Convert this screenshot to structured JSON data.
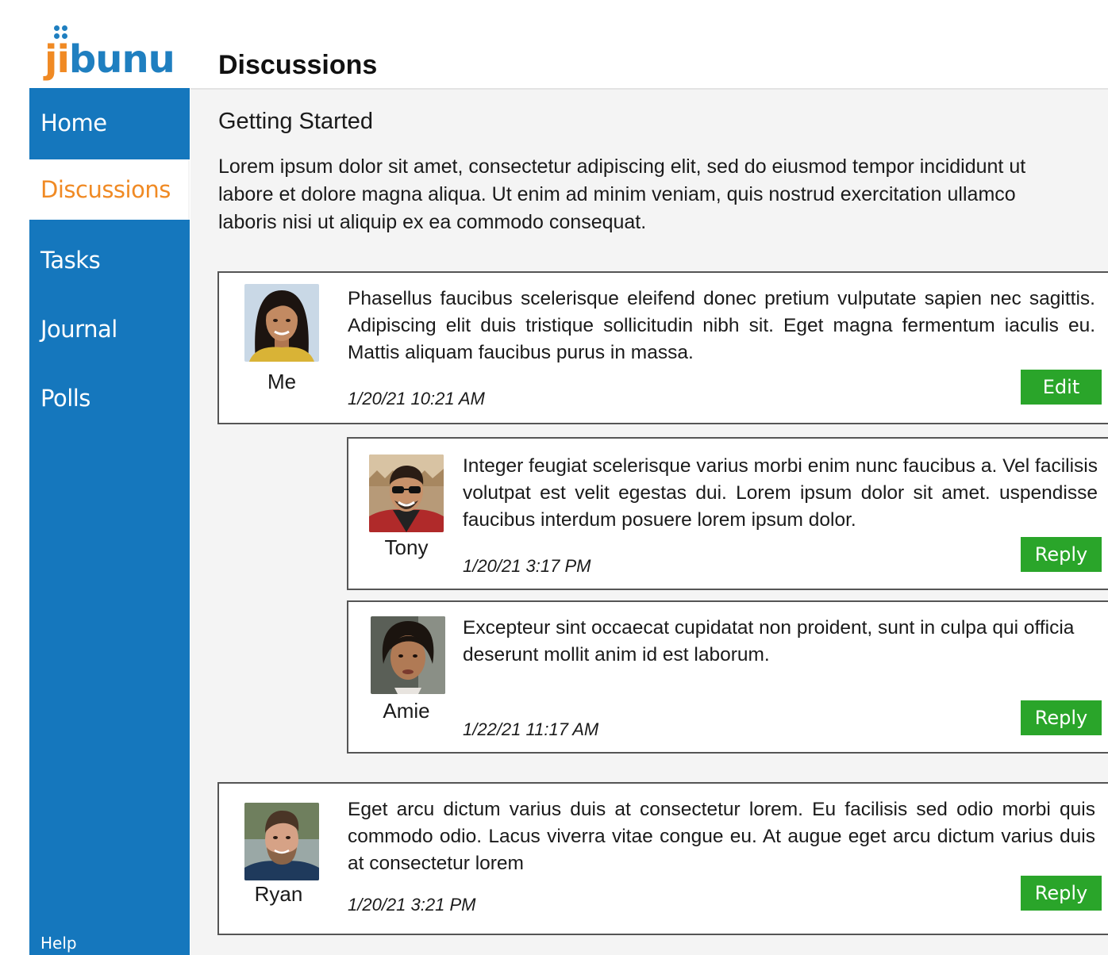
{
  "logo": {
    "prefix": "ji",
    "suffix": "bunu"
  },
  "page_title": "Discussions",
  "sidebar": {
    "items": [
      {
        "label": "Home"
      },
      {
        "label": "Discussions"
      },
      {
        "label": "Tasks"
      },
      {
        "label": "Journal"
      },
      {
        "label": "Polls"
      }
    ],
    "help_label": "Help"
  },
  "topic": {
    "title": "Getting Started",
    "description": [
      "Lorem ipsum dolor sit amet, consectetur adipiscing elit, sed do eiusmod tempor incididunt ut",
      "labore et dolore magna aliqua. Ut enim ad minim veniam, quis nostrud exercitation ullamco",
      "laboris nisi ut aliquip ex ea commodo consequat."
    ]
  },
  "posts": [
    {
      "author": "Me",
      "avatar_icon": "avatar-me-photo",
      "text": "Phasellus faucibus scelerisque eleifend donec pretium vulputate sapien nec sagittis. Adipiscing elit duis tristique sollicitudin nibh sit. Eget magna fermentum iaculis eu. Mattis aliquam faucibus purus in massa.",
      "timestamp": "1/20/21 10:21 AM",
      "button": "Edit"
    },
    {
      "author": "Tony",
      "avatar_icon": "avatar-tony-photo",
      "text": "Integer feugiat scelerisque varius morbi enim nunc faucibus a. Vel facilisis volutpat est velit egestas dui. Lorem ipsum dolor sit amet. uspendisse faucibus interdum posuere lorem ipsum dolor.",
      "timestamp": "1/20/21 3:17 PM",
      "button": "Reply"
    },
    {
      "author": "Amie",
      "avatar_icon": "avatar-amie-photo",
      "text": "Excepteur sint occaecat cupidatat non proident, sunt in culpa qui officia deserunt mollit anim id est laborum.",
      "timestamp": "1/22/21 11:17 AM",
      "button": "Reply"
    },
    {
      "author": "Ryan",
      "avatar_icon": "avatar-ryan-photo",
      "text": "Eget arcu dictum varius duis at consectetur lorem. Eu facilisis sed odio morbi quis commodo odio. Lacus viverra vitae congue eu. At augue eget arcu dictum varius duis at consectetur lorem",
      "timestamp": "1/20/21 3:21 PM",
      "button": "Reply"
    }
  ],
  "colors": {
    "sidebar_bg": "#1577bd",
    "active_nav_text": "#f08a24",
    "button_bg": "#2aa52a",
    "main_bg": "#f4f4f4"
  }
}
